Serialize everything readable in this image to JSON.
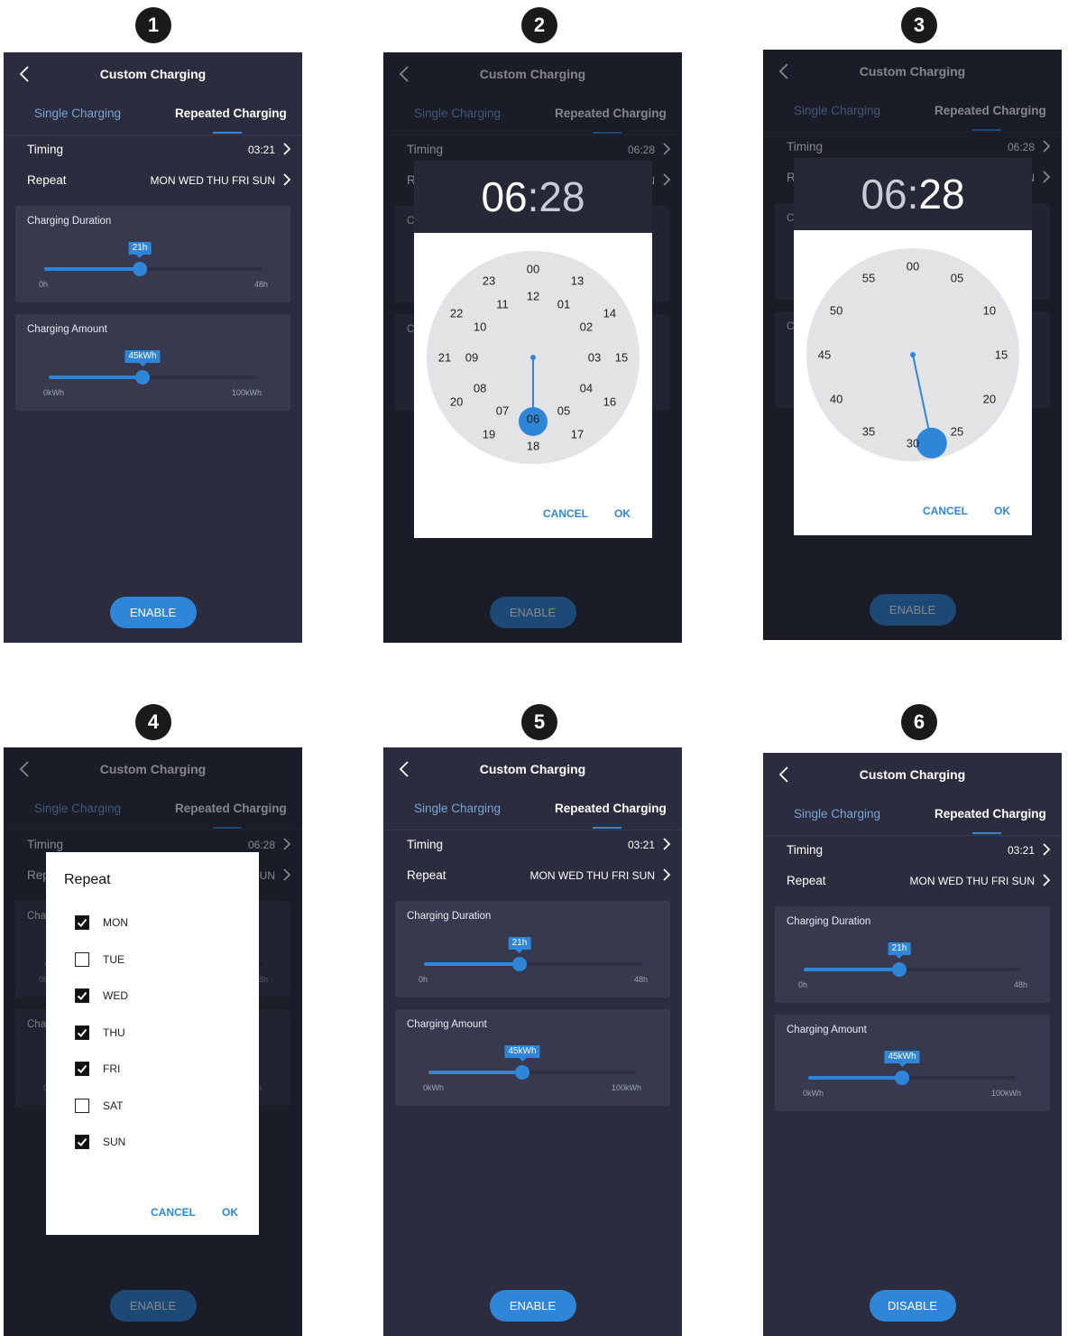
{
  "badges": [
    "1",
    "2",
    "3",
    "4",
    "5",
    "6"
  ],
  "app": {
    "title": "Custom Charging",
    "tabs": [
      "Single Charging",
      "Repeated Charging"
    ],
    "timing_label": "Timing",
    "repeat_label": "Repeat",
    "repeat_days": "MON WED THU FRI SUN",
    "duration": {
      "label": "Charging Duration",
      "value": "21h",
      "min": "0h",
      "max": "48h",
      "fraction": 0.4375
    },
    "amount": {
      "label": "Charging Amount",
      "value": "45kWh",
      "min": "0kWh",
      "max": "100kWh",
      "fraction": 0.45
    },
    "enable_label": "ENABLE",
    "disable_label": "DISABLE"
  },
  "screens": {
    "s1": {
      "timing_value": "03:21"
    },
    "s2": {
      "timing_value": "06:28"
    },
    "s3": {
      "timing_value": "06:28"
    },
    "s4": {
      "timing_value": "06:28"
    },
    "s5": {
      "timing_value": "03:21"
    },
    "s6": {
      "timing_value": "03:21"
    }
  },
  "time_picker": {
    "hour": "06",
    "separator": ":",
    "minute": "28",
    "cancel_label": "CANCEL",
    "ok_label": "OK",
    "hour_outer": [
      "00",
      "13",
      "14",
      "15",
      "16",
      "17",
      "18",
      "19",
      "20",
      "21",
      "22",
      "23"
    ],
    "hour_inner": [
      "12",
      "01",
      "02",
      "03",
      "04",
      "05",
      "06",
      "07",
      "08",
      "09",
      "10",
      "11"
    ],
    "minute_ring": [
      "00",
      "05",
      "10",
      "15",
      "20",
      "25",
      "30",
      "35",
      "40",
      "45",
      "50",
      "55"
    ]
  },
  "repeat_dialog": {
    "title": "Repeat",
    "days": [
      {
        "label": "MON",
        "checked": true
      },
      {
        "label": "TUE",
        "checked": false
      },
      {
        "label": "WED",
        "checked": true
      },
      {
        "label": "THU",
        "checked": true
      },
      {
        "label": "FRI",
        "checked": true
      },
      {
        "label": "SAT",
        "checked": false
      },
      {
        "label": "SUN",
        "checked": true
      }
    ],
    "cancel_label": "CANCEL",
    "ok_label": "OK"
  },
  "colors": {
    "accent": "#2f86d8",
    "screen_bg": "#2b2d3e",
    "card_bg": "#373a4f",
    "dialog_header_bg": "#262836"
  },
  "icons": {
    "back": "chevron-left-icon",
    "forward": "chevron-right-icon",
    "check": "check-icon"
  }
}
